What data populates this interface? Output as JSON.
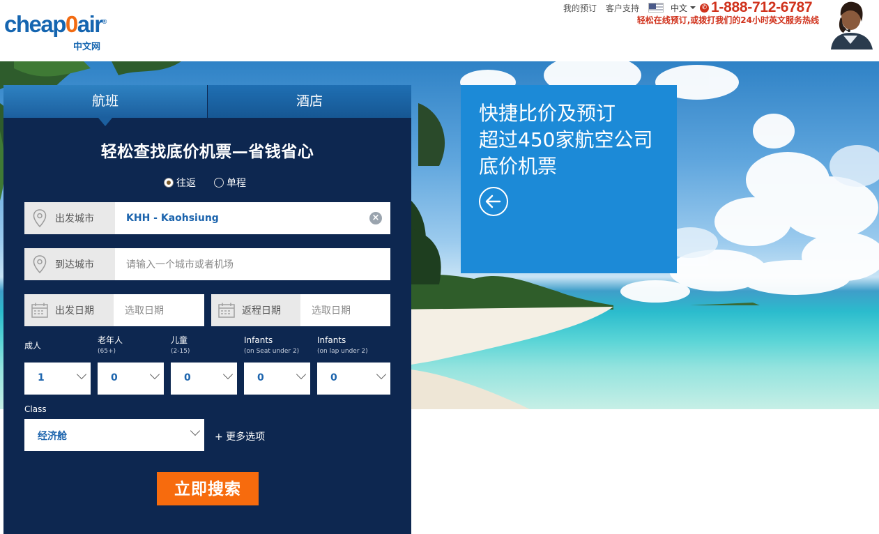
{
  "brand": {
    "logo_prefix": "cheap",
    "logo_zero": "0",
    "logo_suffix": "air",
    "logo_reg": "®",
    "logo_sub": "中文网",
    "accent_color": "#1565b0",
    "orange_color": "#f26b12"
  },
  "header": {
    "my_bookings": "我的预订",
    "support": "客户支持",
    "language": "中文",
    "phone": "1-888-712-6787",
    "tagline": "轻松在线预订,或拨打我们的24小时英文服务热线"
  },
  "tabs": [
    {
      "label": "航班"
    },
    {
      "label": "酒店"
    }
  ],
  "search": {
    "title": "轻松查找底价机票—省钱省心",
    "trip_types": [
      "往返",
      "单程"
    ],
    "selected_trip": "往返",
    "from_label": "出发城市",
    "from_value": "KHH - Kaohsiung",
    "to_label": "到达城市",
    "to_placeholder": "请输入一个城市或者机场",
    "depart_label": "出发日期",
    "depart_placeholder": "选取日期",
    "return_label": "返程日期",
    "return_placeholder": "选取日期",
    "passengers": [
      {
        "label": "成人",
        "sub": "",
        "value": "1"
      },
      {
        "label": "老年人",
        "sub": "(65+)",
        "value": "0"
      },
      {
        "label": "儿童",
        "sub": "(2-15)",
        "value": "0"
      },
      {
        "label": "Infants",
        "sub": "(on Seat under 2)",
        "value": "0"
      },
      {
        "label": "Infants",
        "sub": "(on lap under 2)",
        "value": "0"
      }
    ],
    "class_label": "Class",
    "class_value": "经济舱",
    "more_options": "+ 更多选项",
    "submit": "立即搜索",
    "submit_color": "#f76b0d"
  },
  "promo": {
    "lines": [
      "快捷比价及预订",
      "超过450家航空公司",
      "底价机票"
    ],
    "background": "#1c8ad7",
    "arrow_icon": "arrow-left-circle-icon"
  }
}
